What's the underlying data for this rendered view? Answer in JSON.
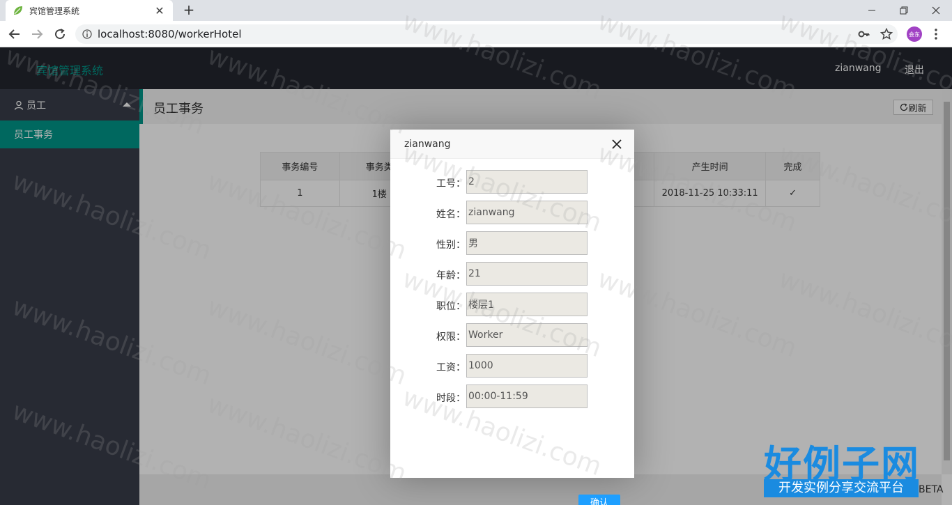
{
  "browser": {
    "tab_title": "宾馆管理系统",
    "url": "localhost:8080/workerHotel",
    "profile_label": "会东"
  },
  "app": {
    "logo": "宾馆管理系统",
    "user": "zianwang",
    "logout": "退出"
  },
  "sidebar": {
    "group_label": "员工",
    "items": [
      {
        "label": "员工事务"
      }
    ]
  },
  "main": {
    "title": "员工事务",
    "refresh_label": "刷新",
    "table": {
      "headers": [
        "事务编号",
        "事务类",
        "",
        "产生时间",
        "完成"
      ],
      "rows": [
        [
          "1",
          "1楼",
          "",
          "2018-11-25 10:33:11",
          "✓"
        ]
      ]
    },
    "beta": "BETA"
  },
  "modal": {
    "title": "zianwang",
    "fields": [
      {
        "label": "工号：",
        "value": "2"
      },
      {
        "label": "姓名：",
        "value": "zianwang"
      },
      {
        "label": "性别：",
        "value": "男"
      },
      {
        "label": "年龄：",
        "value": "21"
      },
      {
        "label": "职位：",
        "value": "楼层1"
      },
      {
        "label": "权限：",
        "value": "Worker"
      },
      {
        "label": "工资：",
        "value": "1000"
      },
      {
        "label": "时段：",
        "value": "00:00-11:59"
      }
    ],
    "confirm_label": "确认"
  },
  "watermark": {
    "text": "www.haolizi.com",
    "brand_main": "好例子网",
    "brand_sub": "开发实例分享交流平台"
  },
  "colors": {
    "accent": "#009688",
    "header_bg": "#23262e",
    "sidebar_bg": "#393d49",
    "confirm": "#1e9fff"
  }
}
